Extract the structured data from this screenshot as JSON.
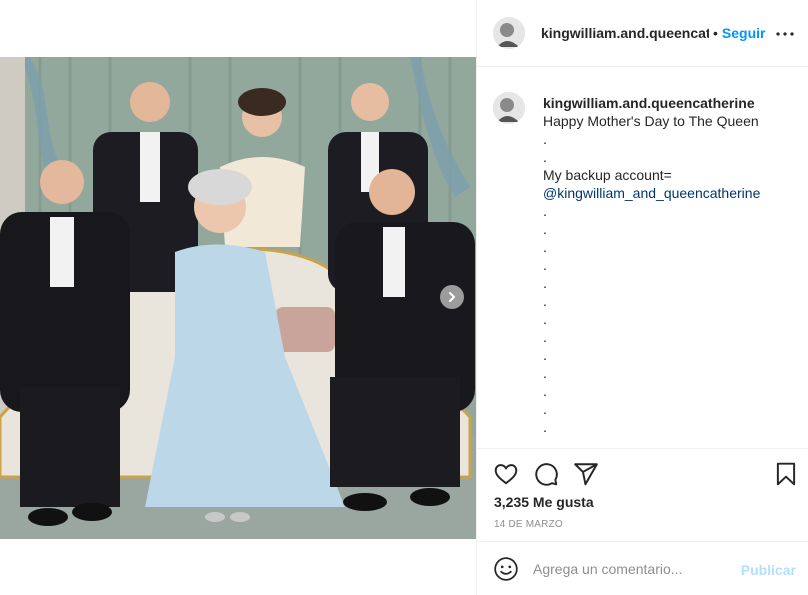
{
  "post": {
    "username": "kingwilliam.and.queencatherine",
    "header_username_display": "kingwilliam.and.queencatl",
    "separator": "•",
    "follow_label": "Seguir",
    "more_icon": "more-options-icon",
    "caption_lines": [
      "Happy Mother's Day to The Queen",
      ".",
      ".",
      "My backup account="
    ],
    "mention": "@kingwilliam_and_queencatherine",
    "trailing_dots": [
      ".",
      ".",
      ".",
      ".",
      ".",
      ".",
      ".",
      ".",
      ".",
      ".",
      ".",
      ".",
      "."
    ],
    "likes": "3,235 Me gusta",
    "date": "14 DE MARZO"
  },
  "carousel": {
    "next_icon": "chevron-right-icon"
  },
  "actions": {
    "like_icon": "heart-icon",
    "comment_icon": "comment-icon",
    "share_icon": "share-icon",
    "save_icon": "bookmark-icon"
  },
  "comment": {
    "placeholder": "Agrega un comentario...",
    "publish_label": "Publicar",
    "emoji_icon": "emoji-icon"
  },
  "colors": {
    "accent": "#0095f6",
    "publish_disabled": "#b2dffc",
    "mention": "#00376b",
    "muted": "#8e8e8e"
  }
}
